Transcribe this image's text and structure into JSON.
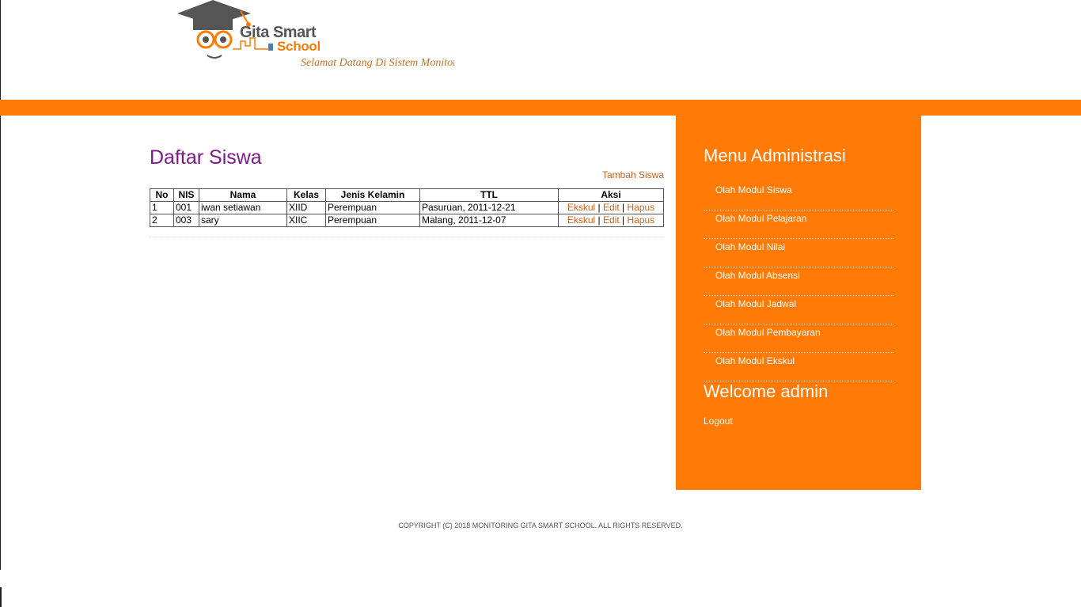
{
  "header": {
    "logo_title": "Gita Smart",
    "logo_subtitle": "School",
    "marquee": "Selamat Datang Di Sistem Monitoring Gita Smart School"
  },
  "main": {
    "title": "Daftar Siswa",
    "add_link": "Tambah Siswa",
    "table": {
      "headers": [
        "No",
        "NIS",
        "Nama",
        "Kelas",
        "Jenis Kelamin",
        "TTL",
        "Aksi"
      ],
      "rows": [
        {
          "no": "1",
          "nis": "001",
          "nama": "iwan setiawan",
          "kelas": "XIID",
          "jk": "Perempuan",
          "ttl": "Pasuruan, 2011-12-21"
        },
        {
          "no": "2",
          "nis": "003",
          "nama": "sary",
          "kelas": "XIIC",
          "jk": "Perempuan",
          "ttl": "Malang, 2011-12-07"
        }
      ],
      "actions": {
        "ekskul": "Ekskul",
        "edit": "Edit",
        "hapus": "Hapus",
        "sep": "|"
      }
    }
  },
  "sidebar": {
    "title": "Menu Administrasi",
    "items": [
      "Olah Modul Siswa",
      "Olah Modul Pelajaran",
      "Olah Modul Nilai",
      "Olah Modul Absensi",
      "Olah Modul Jadwal",
      "Olah Modul Pembayaran",
      "Olah Modul Ekskul"
    ],
    "welcome": "Welcome admin",
    "logout": "Logout"
  },
  "footer": "COPYRIGHT (C) 2018 MONITORING GITA SMART SCHOOL. ALL RIGHTS RESERVED.",
  "colors": {
    "accent": "#ff7a06",
    "link": "#c9631e",
    "title": "#7d1a8a"
  }
}
